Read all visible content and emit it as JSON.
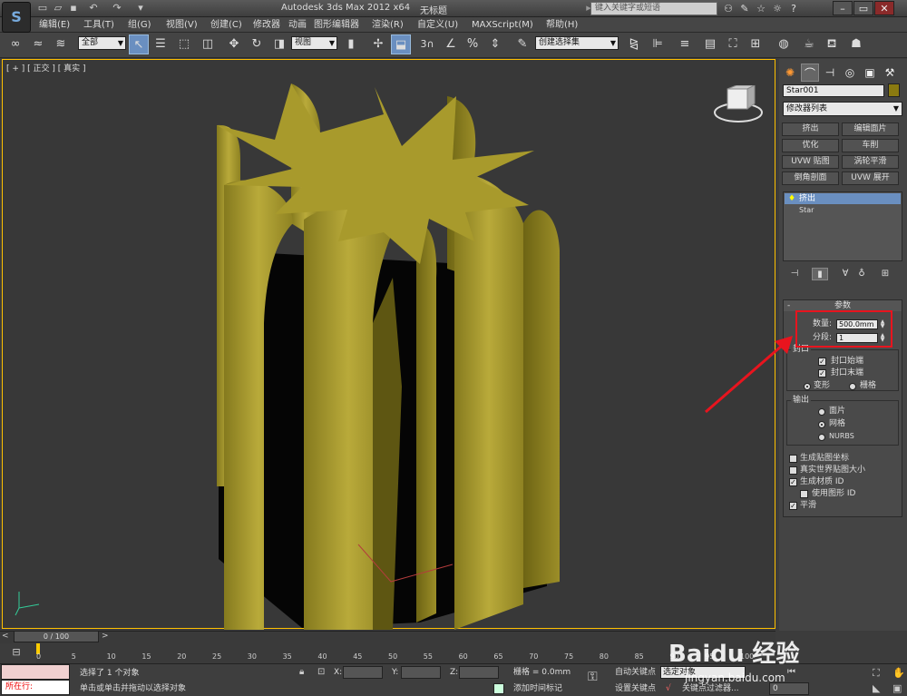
{
  "titlebar": {
    "title": "Autodesk 3ds Max  2012 x64",
    "file": "无标题",
    "search_placeholder": "键入关键字或短语",
    "help": "?"
  },
  "menus": [
    "编辑(E)",
    "工具(T)",
    "组(G)",
    "视图(V)",
    "创建(C)",
    "修改器",
    "动画",
    "图形编辑器",
    "渲染(R)",
    "自定义(U)",
    "MAXScript(M)",
    "帮助(H)"
  ],
  "toolbar": {
    "filter": "全部",
    "ref_coord": "视图",
    "snap_3": "3",
    "named_sel": "创建选择集"
  },
  "viewport": {
    "label": "[ + ] [ 正交 ] [ 真实 ]"
  },
  "panel": {
    "object_name": "Star001",
    "modifier_list": "修改器列表",
    "mod_buttons": [
      "挤出",
      "编辑面片",
      "优化",
      "车削",
      "UVW 贴图",
      "涡轮平滑",
      "倒角剖面",
      "UVW 展开"
    ],
    "stack": [
      "挤出",
      "Star"
    ],
    "params": {
      "title": "参数",
      "amount_label": "数量:",
      "amount": "500.0mm",
      "segments_label": "分段:",
      "segments": "1",
      "capping_title": "封口",
      "cap_start": "封口始端",
      "cap_end": "封口末端",
      "morph": "变形",
      "grid": "栅格",
      "output_title": "输出",
      "out_patch": "面片",
      "out_mesh": "网格",
      "out_nurbs": "NURBS",
      "gen_map": "生成贴图坐标",
      "real_world": "真实世界贴图大小",
      "gen_mat": "生成材质 ID",
      "use_shape": "使用图形 ID",
      "smooth": "平滑"
    }
  },
  "timeline": {
    "slider": "0 / 100",
    "ticks": [
      "0",
      "5",
      "10",
      "15",
      "20",
      "25",
      "30",
      "35",
      "40",
      "45",
      "50",
      "55",
      "60",
      "65",
      "70",
      "75",
      "80",
      "85",
      "90",
      "95",
      "100"
    ]
  },
  "status": {
    "running": "所在行:",
    "selected": "选择了 1 个对象",
    "prompt": "单击或单击并拖动以选择对象",
    "x": "X:",
    "y": "Y:",
    "z": "Z:",
    "grid": "栅格 = 0.0mm",
    "add_time_tag": "添加时间标记",
    "auto_key": "自动关键点",
    "set_key": "设置关键点",
    "selected_obj": "选定对象",
    "key_filter": "关键点过滤器...",
    "frame": "0"
  },
  "watermark": "Baidu 经验",
  "watermark_url": "jingyan.baidu.com",
  "colors": {
    "object": "#b6a634",
    "viewport_border": "#ffc000",
    "highlight": "#e8141e"
  }
}
